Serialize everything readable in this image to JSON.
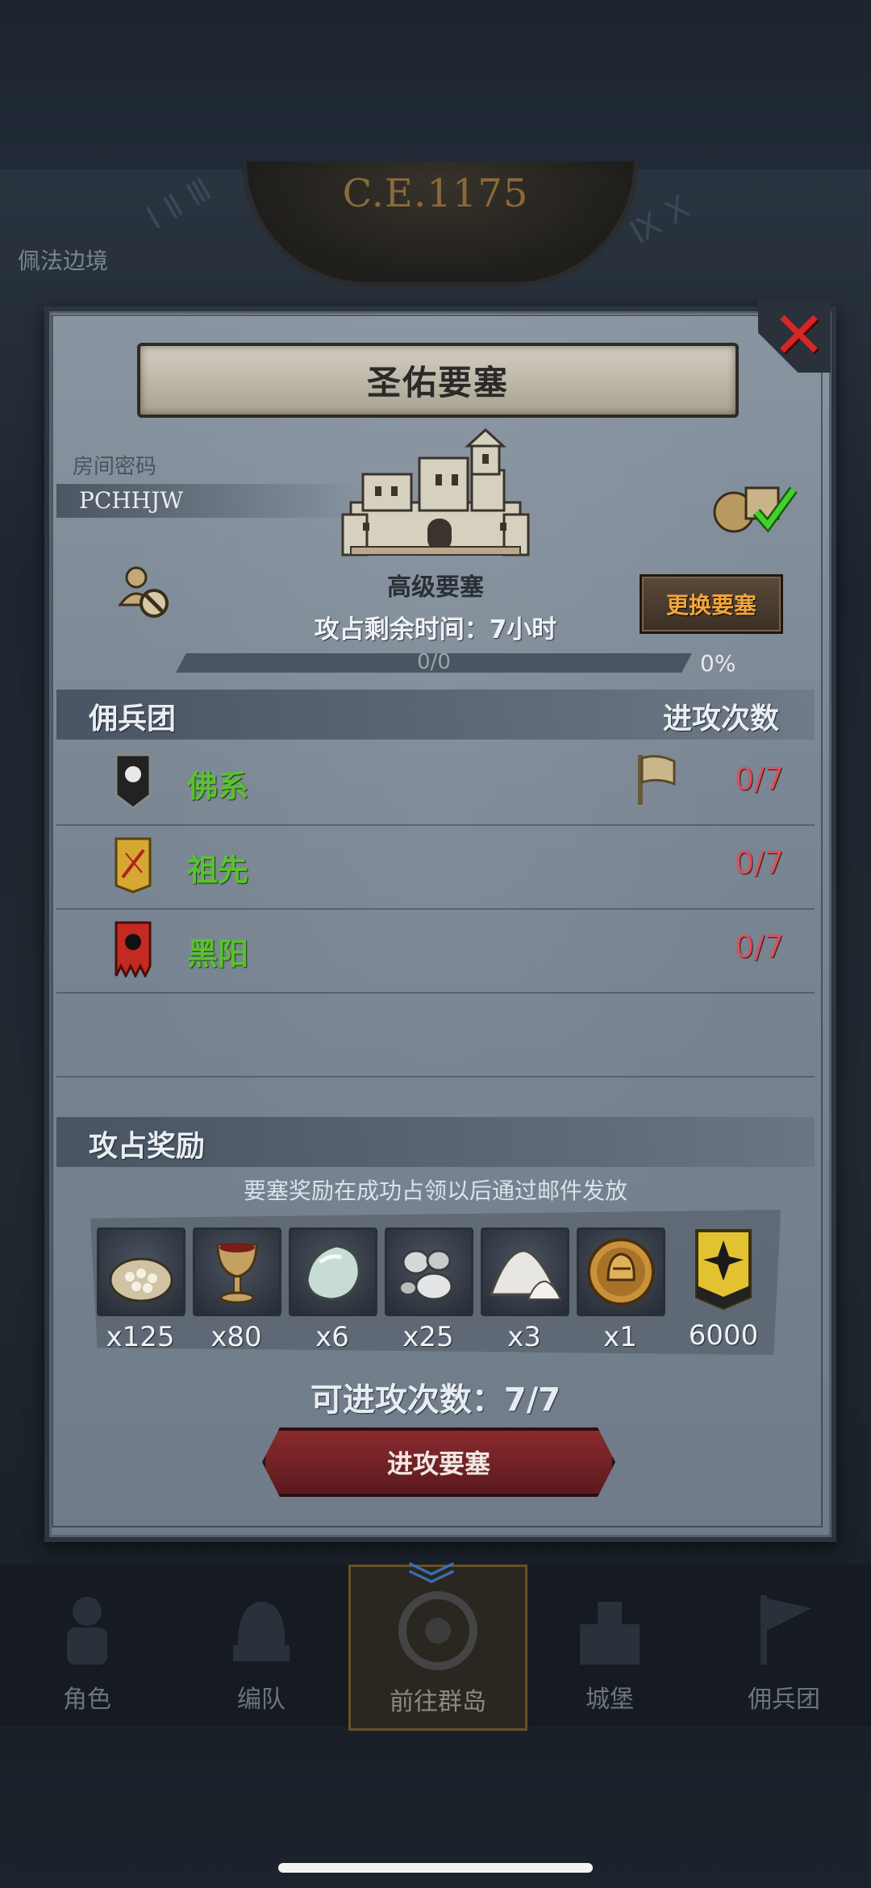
{
  "background": {
    "era": "C.E.1175",
    "map_label": "佩法边境"
  },
  "dialog": {
    "title": "圣佑要塞",
    "room_label": "房间密码",
    "room_code": "PCHHJW",
    "fortress_type": "高级要塞",
    "change_button": "更换要塞",
    "time_label": "攻占剩余时间：7小时",
    "progress_text": "0/0",
    "progress_value": 0,
    "progress_percent": "0%",
    "mercenary_header": "佣兵团",
    "attack_count_header": "进攻次数",
    "guilds": [
      {
        "name": "佛系",
        "count": "0/7",
        "banner": "white-sun-banner-icon",
        "has_flag": true
      },
      {
        "name": "祖先",
        "count": "0/7",
        "banner": "yellow-slash-banner-icon",
        "has_flag": false
      },
      {
        "name": "黑阳",
        "count": "0/7",
        "banner": "red-black-sun-banner-icon",
        "has_flag": false
      }
    ],
    "reward_header": "攻占奖励",
    "reward_note": "要塞奖励在成功占领以后通过邮件发放",
    "rewards": [
      {
        "icon": "grain-sack-icon",
        "qty": "x125"
      },
      {
        "icon": "wine-goblet-icon",
        "qty": "x80"
      },
      {
        "icon": "pale-gem-icon",
        "qty": "x6"
      },
      {
        "icon": "silver-ore-icon",
        "qty": "x25"
      },
      {
        "icon": "salt-pile-icon",
        "qty": "x3"
      },
      {
        "icon": "knight-medal-icon",
        "qty": "x1"
      },
      {
        "icon": "guild-banner-emblem-icon",
        "qty": "6000"
      }
    ],
    "attempts_label": "可进攻次数：7/7",
    "attack_button": "进攻要塞"
  },
  "nav": {
    "items": [
      {
        "label": "角色",
        "icon": "knight-icon"
      },
      {
        "label": "编队",
        "icon": "helmet-icon"
      },
      {
        "label": "前往群岛",
        "icon": "compass-icon"
      },
      {
        "label": "城堡",
        "icon": "castle-icon"
      },
      {
        "label": "佣兵团",
        "icon": "flag-icon"
      }
    ],
    "active_index": 2
  },
  "colors": {
    "guild_name": "#5bc034",
    "attack_count": "#d9525c",
    "change_button_text": "#f2a63a",
    "close_x": "#d42626"
  }
}
